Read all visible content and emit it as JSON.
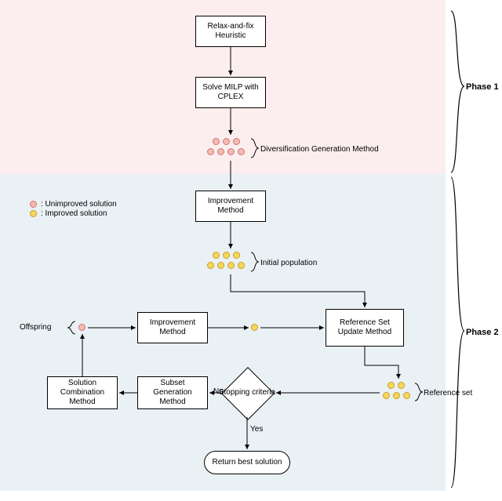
{
  "phases": {
    "p1": "Phase 1",
    "p2": "Phase 2"
  },
  "boxes": {
    "relax": "Relax-and-fix Heuristic",
    "milp": "Solve MILP with CPLEX",
    "improve1": "Improvement Method",
    "improve2": "Improvement Method",
    "refset": "Reference Set Update Method",
    "subset": "Subset Generation Method",
    "combine": "Solution Combination Method",
    "stop": "Stopping criteria",
    "return": "Return best solution"
  },
  "annotations": {
    "divgen": "Diversification Generation Method",
    "initpop": "Initial population",
    "refset": "Reference set",
    "offspring": "Offspring"
  },
  "legend": {
    "unimproved": ": Unimproved solution",
    "improved": ": Improved solution"
  },
  "edges": {
    "no": "No",
    "yes": "Yes"
  }
}
